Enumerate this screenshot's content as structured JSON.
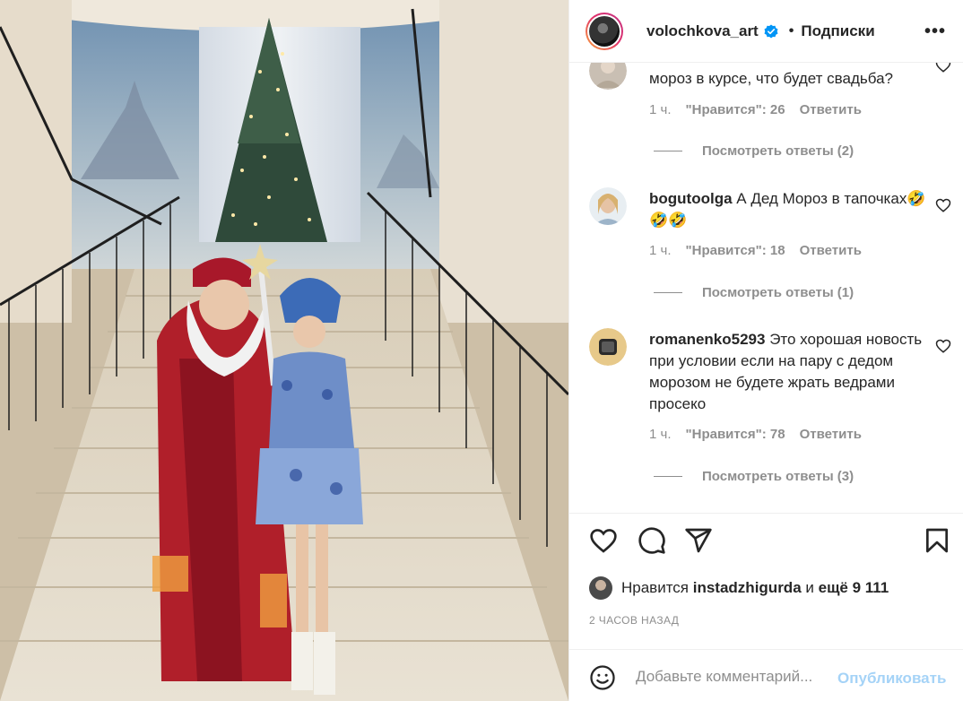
{
  "header": {
    "username": "volochkova_art",
    "separator": "•",
    "follow_label": "Подписки",
    "more_label": "•••"
  },
  "comments": [
    {
      "username": "",
      "text": "мороз в курсе, что будет свадьба?",
      "time": "1 ч.",
      "likes": "\"Нравится\": 26",
      "reply": "Ответить",
      "view_replies": "Посмотреть ответы (2)"
    },
    {
      "username": "bogutoolga",
      "text": "А Дед Мороз в тапочках🤣🤣🤣",
      "time": "1 ч.",
      "likes": "\"Нравится\": 18",
      "reply": "Ответить",
      "view_replies": "Посмотреть ответы (1)"
    },
    {
      "username": "romanenko5293",
      "text": "Это хорошая новость при условии если на пару с дедом морозом не будете жрать ведрами просеко",
      "time": "1 ч.",
      "likes": "\"Нравится\": 78",
      "reply": "Ответить",
      "view_replies": "Посмотреть ответы (3)"
    }
  ],
  "likes": {
    "prefix": "Нравится",
    "user": "instadzhigurda",
    "middle": "и",
    "rest": "ещё 9 111"
  },
  "time_ago": "2 ЧАСОВ НАЗАД",
  "add_comment": {
    "placeholder": "Добавьте комментарий...",
    "publish_label": "Опубликовать"
  },
  "icons": [
    "heart-icon",
    "comment-icon",
    "share-icon",
    "bookmark-icon",
    "emoji-icon",
    "verified-icon",
    "more-icon"
  ],
  "colors": {
    "accent": "#0095f6",
    "publish_disabled": "#a5d3f7",
    "secondary_text": "#8e8e8e",
    "primary_text": "#262626"
  }
}
